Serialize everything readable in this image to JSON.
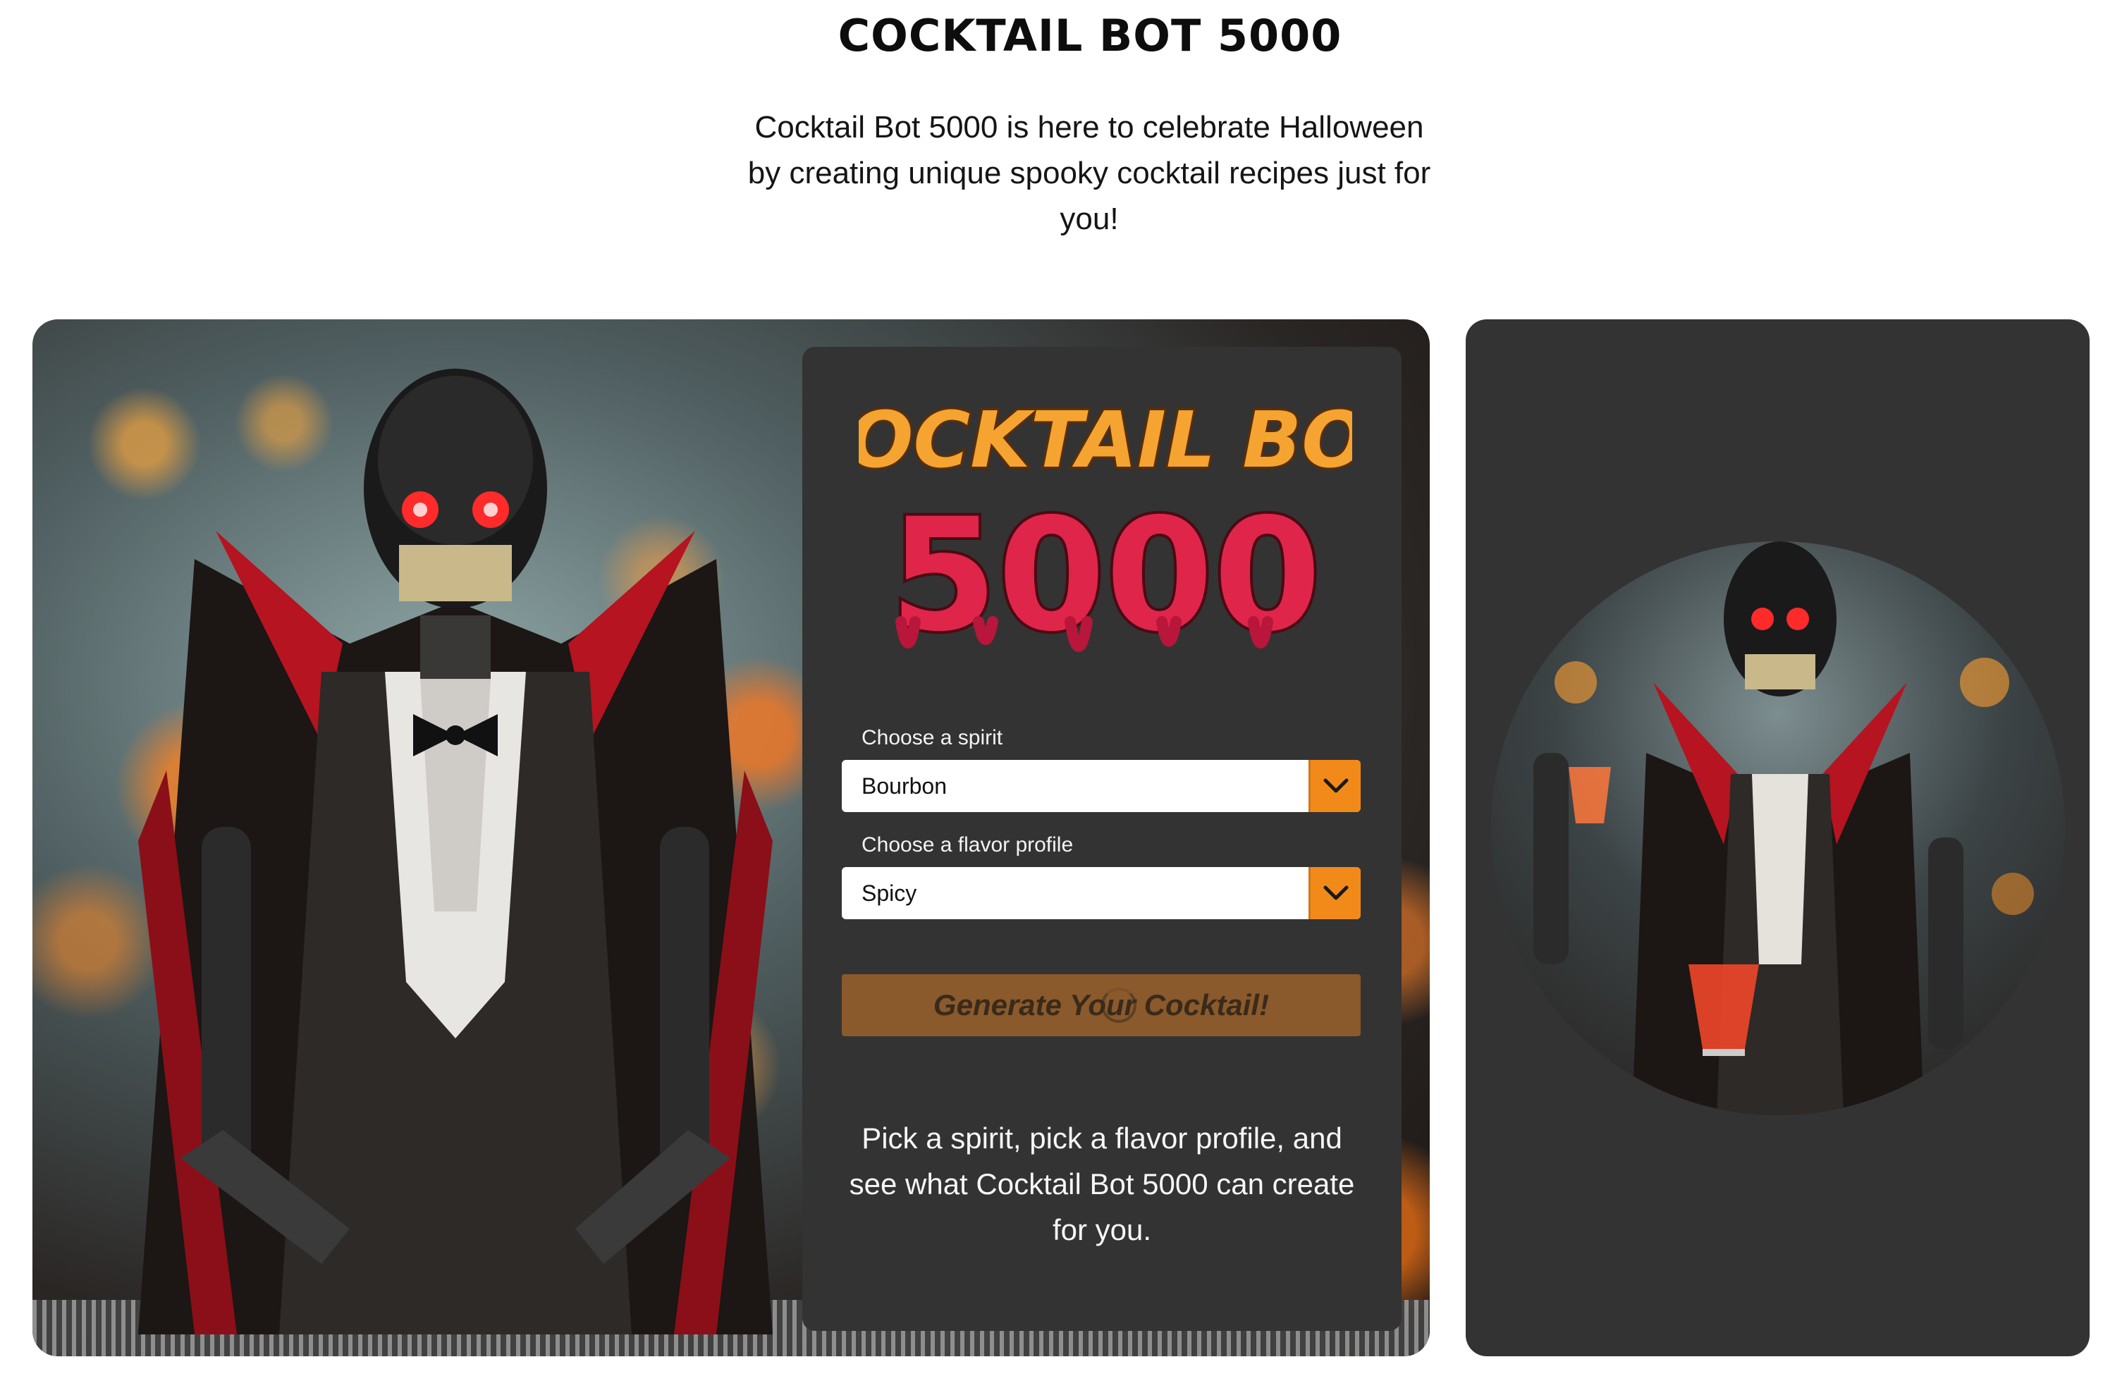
{
  "header": {
    "title": "COCKTAIL BOT 5000",
    "intro": "Cocktail Bot 5000 is here to celebrate Halloween by creating unique spooky cocktail recipes just for you!"
  },
  "form": {
    "logo_line1": "COCKTAIL BOT",
    "logo_line2": "5000",
    "spirit_label": "Choose a spirit",
    "spirit_value": "Bourbon",
    "flavor_label": "Choose a flavor profile",
    "flavor_value": "Spicy",
    "generate_label": "Generate Your Cocktail!",
    "help_text": "Pick a spirit, pick a flavor profile, and see what Cocktail Bot 5000 can create for you."
  },
  "icons": {
    "dropdown": "chevron-down-icon",
    "loading": "spinner-icon"
  },
  "colors": {
    "panel_bg": "#333333",
    "accent_orange": "#f28a1a",
    "button_bg": "#8a5a2c",
    "logo_orange": "#f5a431",
    "logo_red": "#e0254a"
  }
}
